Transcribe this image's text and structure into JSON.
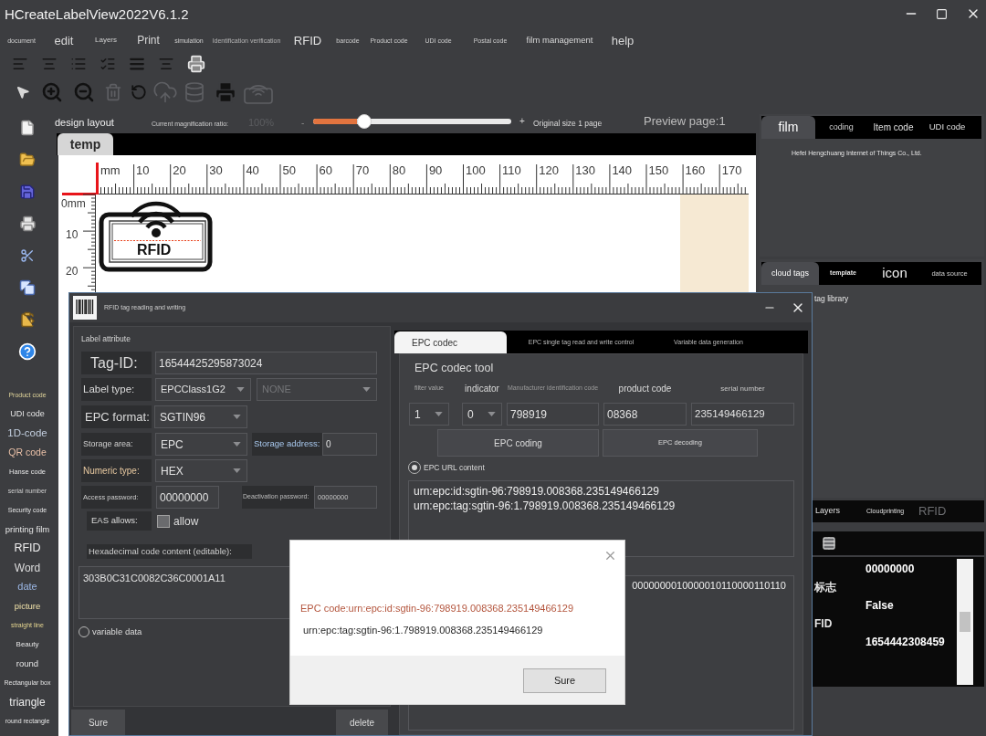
{
  "window": {
    "title": "HCreateLabelView2022V6.1.2"
  },
  "menu": [
    "document",
    "edit",
    "Layers",
    "Print",
    "simulation",
    "Identification verification",
    "RFID",
    "barcode",
    "Product code",
    "UDI code",
    "Postal code",
    "film management",
    "help"
  ],
  "toolbar": {
    "tools": [
      {
        "disabled": false
      },
      {
        "disabled": false
      },
      {
        "disabled": false
      },
      {
        "disabled": true
      },
      {
        "disabled": false
      },
      {
        "disabled": true
      },
      {
        "disabled": true
      },
      {
        "disabled": false
      },
      {
        "disabled": true
      }
    ]
  },
  "sidebar": {
    "items": [
      "Product code",
      "UDI code",
      "1D-code",
      "QR code",
      "Hanse code",
      "serial number",
      "Security code",
      "printing film",
      "RFID",
      "Word",
      "date",
      "picture",
      "straight line",
      "Beauty",
      "round",
      "Rectangular box",
      "triangle",
      "round rectangle"
    ]
  },
  "design_bar": {
    "title": "design layout",
    "zoom_label": "Current magnification ratio:",
    "zoom_value": "100%",
    "zoom_minus": "-",
    "zoom": {
      "level": 0.26
    },
    "zoom_plus": "+",
    "original_size": "Original size 1 page",
    "preview": "Preview page:1"
  },
  "document_tabs": [
    {
      "label": "temp",
      "selected": true
    }
  ],
  "canvas": {
    "unit": "mm",
    "h_ruler": [
      "10",
      "20",
      "30",
      "40",
      "50",
      "60",
      "70",
      "80",
      "90",
      "100",
      "110",
      "120",
      "130",
      "140",
      "150",
      "160",
      "170"
    ],
    "v_ruler": [
      "0mm",
      "10",
      "20"
    ],
    "label_text": "RFID"
  },
  "right_panels": [
    {
      "tabs": [
        {
          "label": "film",
          "selected": true
        },
        {
          "label": "coding",
          "selected": false
        },
        {
          "label": "Item code",
          "selected": false
        },
        {
          "label": "UDI code",
          "selected": false
        }
      ],
      "items": [
        "Hefei Hengchuang Internet of Things Co., Ltd."
      ]
    },
    {
      "tabs": [
        {
          "label": "cloud tags",
          "selected": true
        },
        {
          "label": "template",
          "selected": false
        },
        {
          "label": "icon",
          "selected": false
        },
        {
          "label": "data source",
          "selected": false
        }
      ],
      "items": [
        "tag library"
      ]
    },
    {
      "tabs": [
        {
          "label": "Layers",
          "selected": false,
          "disabled": false
        },
        {
          "label": "Cloudprinting",
          "selected": false,
          "disabled": false
        },
        {
          "label": "RFID",
          "selected": false,
          "disabled": true
        }
      ]
    }
  ],
  "property_grid": {
    "names": [
      "标志",
      "FID"
    ],
    "values": [
      "00000000",
      "False",
      "1654442308459"
    ]
  },
  "rfid_dialog": {
    "title": "RFID tag reading and writing",
    "label_attribute": {
      "title": "Label attribute",
      "tag_id": {
        "label": "Tag-ID:",
        "value": "16544425295873024"
      },
      "label_type": {
        "label": "Label type:",
        "value": "EPCClass1G2",
        "secondary": {
          "value": "NONE",
          "disabled": true
        }
      },
      "epc_format": {
        "label": "EPC format:",
        "value": "SGTIN96"
      },
      "storage_area": {
        "label": "Storage area:",
        "value": "EPC"
      },
      "storage_address": {
        "label": "Storage address:",
        "value": "0"
      },
      "numeric_type": {
        "label": "Numeric type:",
        "value": "HEX"
      },
      "access_password": {
        "label": "Access password:",
        "value": "00000000"
      },
      "deactivation_password": {
        "label": "Deactivation password:",
        "value": "00000000"
      },
      "eas": {
        "label": "EAS allows:",
        "option": "allow",
        "checked": false
      },
      "hex_content": {
        "label": "Hexadecimal code content (editable):",
        "value": "303B0C31C0082C36C0001A11"
      },
      "variable_data": {
        "label": "variable data",
        "selected": false
      }
    },
    "tabs": [
      {
        "label": "EPC codec",
        "selected": true
      },
      {
        "label": "EPC single tag read and write control",
        "selected": false
      },
      {
        "label": "Variable data generation",
        "selected": false
      }
    ],
    "codec": {
      "title": "EPC codec tool",
      "fields": [
        {
          "label": "filter value",
          "value": "1",
          "kind": "select"
        },
        {
          "label": "indicator",
          "value": "0",
          "kind": "select"
        },
        {
          "label": "Manufacturer identification code",
          "value": "798919",
          "kind": "input"
        },
        {
          "label": "product code",
          "value": "08368",
          "kind": "input"
        },
        {
          "label": "serial number",
          "value": "235149466129",
          "kind": "input"
        }
      ],
      "buttons": [
        "EPC coding",
        "EPC decoding"
      ],
      "url_option": {
        "label": "EPC URL content",
        "selected": true
      },
      "url_content": [
        "urn:epc:id:sgtin-96:798919.008368.235149466129",
        "urn:epc:tag:sgtin-96:1.798919.008368.235149466129"
      ],
      "binary_content": "0000000010000010110000110110"
    },
    "buttons": [
      "Sure",
      "delete"
    ]
  },
  "message_box": {
    "lines": [
      "EPC code:urn:epc:id:sgtin-96:798919.008368.235149466129",
      "urn:epc:tag:sgtin-96:1.798919.008368.235149466129"
    ],
    "button": "Sure"
  }
}
